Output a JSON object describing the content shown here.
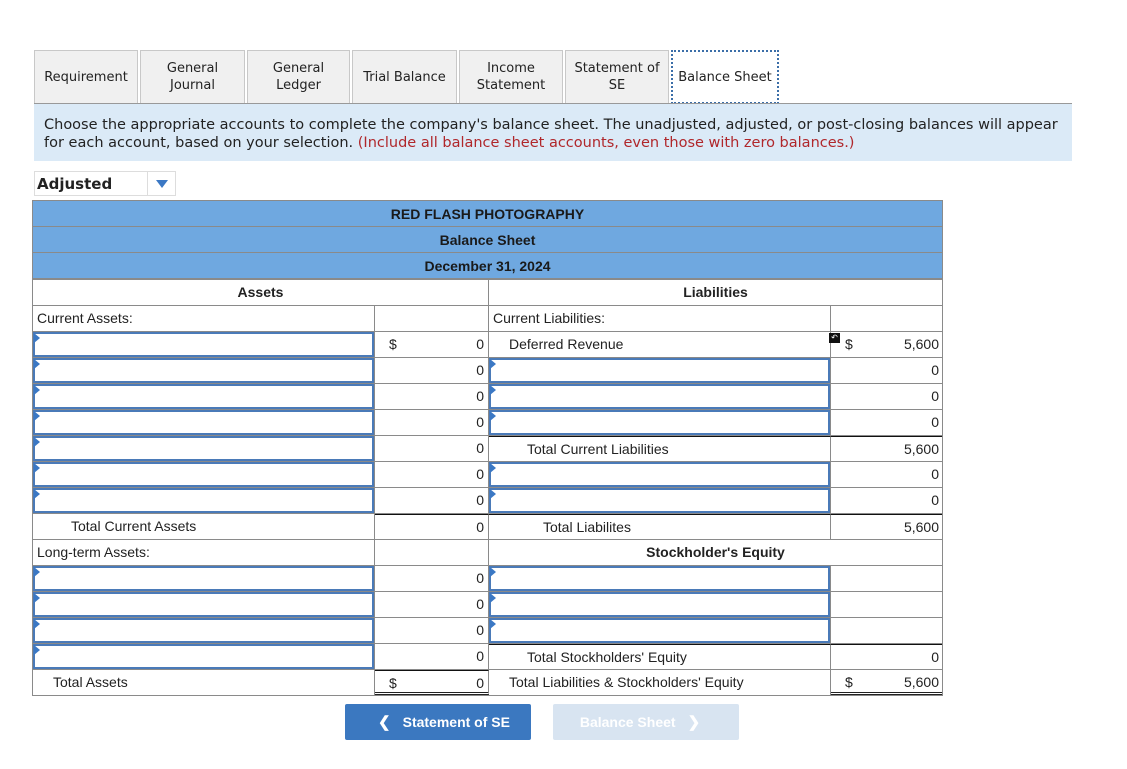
{
  "tabs": [
    {
      "label": "Requirement",
      "active": false
    },
    {
      "label": "General\nJournal",
      "active": false
    },
    {
      "label": "General\nLedger",
      "active": false
    },
    {
      "label": "Trial Balance",
      "active": false
    },
    {
      "label": "Income\nStatement",
      "active": false
    },
    {
      "label": "Statement of\nSE",
      "active": false
    },
    {
      "label": "Balance Sheet",
      "active": true
    }
  ],
  "instructions": {
    "text": "Choose the appropriate accounts to complete the company's balance sheet. The unadjusted, adjusted, or post-closing balances will appear for each account, based on your selection.",
    "note": "(Include all balance sheet accounts, even those with zero balances.)"
  },
  "balance_type": {
    "selected": "Adjusted"
  },
  "sheet": {
    "company": "RED FLASH PHOTOGRAPHY",
    "title": "Balance Sheet",
    "date": "December 31, 2024",
    "assets_header": "Assets",
    "liabilities_header": "Liabilities",
    "current_assets_label": "Current Assets:",
    "current_liabilities_label": "Current Liabilities:",
    "currency": "$",
    "current_asset_amounts": [
      "0",
      "0",
      "0",
      "0",
      "0",
      "0",
      "0"
    ],
    "deferred_revenue": {
      "label": "Deferred Revenue",
      "amount": "5,600"
    },
    "current_liability_amounts": [
      "0",
      "0",
      "0"
    ],
    "total_current_liabilities": {
      "label": "Total Current Liabilities",
      "amount": "5,600"
    },
    "other_liability_amounts": [
      "0",
      "0"
    ],
    "total_current_assets": {
      "label": "Total Current Assets",
      "amount": "0"
    },
    "total_liabilities": {
      "label": "Total Liabilites",
      "amount": "5,600"
    },
    "long_term_assets_label": "Long-term Assets:",
    "equity_header": "Stockholder's Equity",
    "long_term_asset_amounts": [
      "0",
      "0",
      "0",
      "0"
    ],
    "total_equity": {
      "label": "Total Stockholders' Equity",
      "amount": "0"
    },
    "total_assets": {
      "label": "Total Assets",
      "amount": "0"
    },
    "total_liab_equity": {
      "label": "Total Liabilities & Stockholders' Equity",
      "amount": "5,600"
    }
  },
  "nav": {
    "prev_label": "Statement of SE",
    "next_label": "Balance Sheet"
  }
}
